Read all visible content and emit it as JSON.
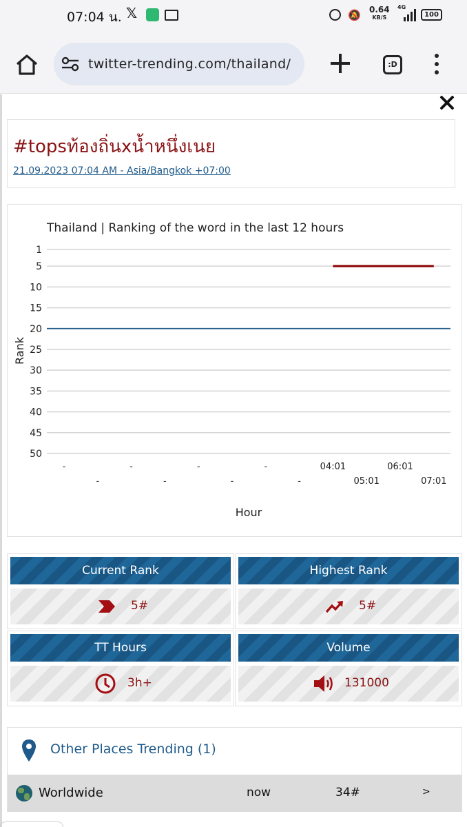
{
  "status_bar": {
    "time": "07:04 น.",
    "net_speed": "0.64",
    "net_unit": "KB/S",
    "network": "4G",
    "battery": "100"
  },
  "browser": {
    "url": "twitter-trending.com/thailand/",
    "tabs_label": ":D"
  },
  "page": {
    "hashtag": "#topsท้องถิ่นxน้ำหนึ่งเนย",
    "timestamp": "21.09.2023 07:04 AM - Asia/Bangkok +07:00"
  },
  "chart_data": {
    "type": "line",
    "title": "Thailand | Ranking of the word in the last 12 hours",
    "xlabel": "Hour",
    "ylabel": "Rank",
    "y_ticks": [
      1,
      5,
      10,
      15,
      20,
      25,
      30,
      35,
      40,
      45,
      50
    ],
    "ylim": [
      1,
      50
    ],
    "y_inverted": true,
    "grid": true,
    "x": [
      "-",
      "-",
      "-",
      "-",
      "-",
      "-",
      "-",
      "-",
      "04:01",
      "05:01",
      "06:01",
      "07:01"
    ],
    "series": [
      {
        "values": [
          null,
          null,
          null,
          null,
          null,
          null,
          null,
          null,
          5,
          5,
          5,
          5
        ],
        "color": "#8b0000"
      }
    ],
    "reference_line": {
      "value": 20,
      "color": "#1f5a8a"
    }
  },
  "stats": {
    "current_rank": {
      "label": "Current Rank",
      "value": "5#"
    },
    "highest_rank": {
      "label": "Highest Rank",
      "value": "5#"
    },
    "tt_hours": {
      "label": "TT Hours",
      "value": "3h+"
    },
    "volume": {
      "label": "Volume",
      "value": "131000"
    }
  },
  "other_places": {
    "title": "Other Places Trending (1)",
    "rows": [
      {
        "name": "Worldwide",
        "time": "now",
        "rank": "34#",
        "arrow": ">"
      }
    ]
  },
  "colors": {
    "accent_red": "#8b1214",
    "accent_blue": "#1f6699"
  }
}
